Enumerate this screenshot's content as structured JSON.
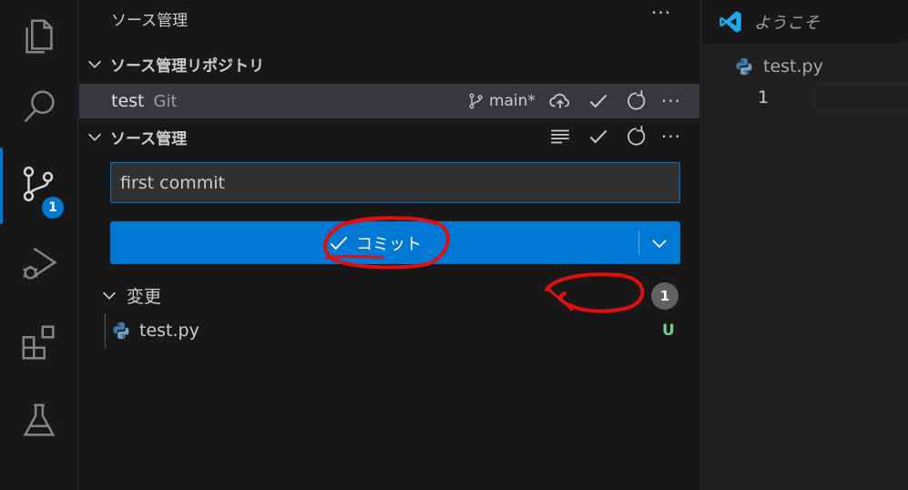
{
  "activity_bar": {
    "items": [
      "explorer",
      "search",
      "source-control",
      "run-and-debug",
      "extensions",
      "testing"
    ],
    "source_control_badge": "1"
  },
  "sidebar": {
    "title": "ソース管理",
    "more": "···",
    "repositories_section": {
      "label": "ソース管理リポジトリ",
      "repo": {
        "name": "test",
        "kind": "Git",
        "branch": "main*",
        "more": "···"
      }
    },
    "source_control_section": {
      "label": "ソース管理",
      "more": "···",
      "commit_message": "first commit",
      "commit_button_label": "コミット",
      "changes": {
        "label": "変更",
        "count": "1",
        "files": [
          {
            "name": "test.py",
            "status": "U"
          }
        ]
      }
    }
  },
  "editor": {
    "tab_label": "ようこそ",
    "breadcrumb_file": "test.py",
    "line_number": "1"
  },
  "colors": {
    "accent": "#0078d4",
    "untracked": "#73c991",
    "annotation": "#e01010"
  },
  "icons": [
    "files-icon",
    "search-icon",
    "source-control-icon",
    "run-debug-icon",
    "extensions-icon",
    "testing-icon",
    "branch-icon",
    "cloud-upload-icon",
    "check-icon",
    "refresh-icon",
    "list-icon",
    "chevron-down-icon",
    "python-icon",
    "vscode-icon"
  ]
}
